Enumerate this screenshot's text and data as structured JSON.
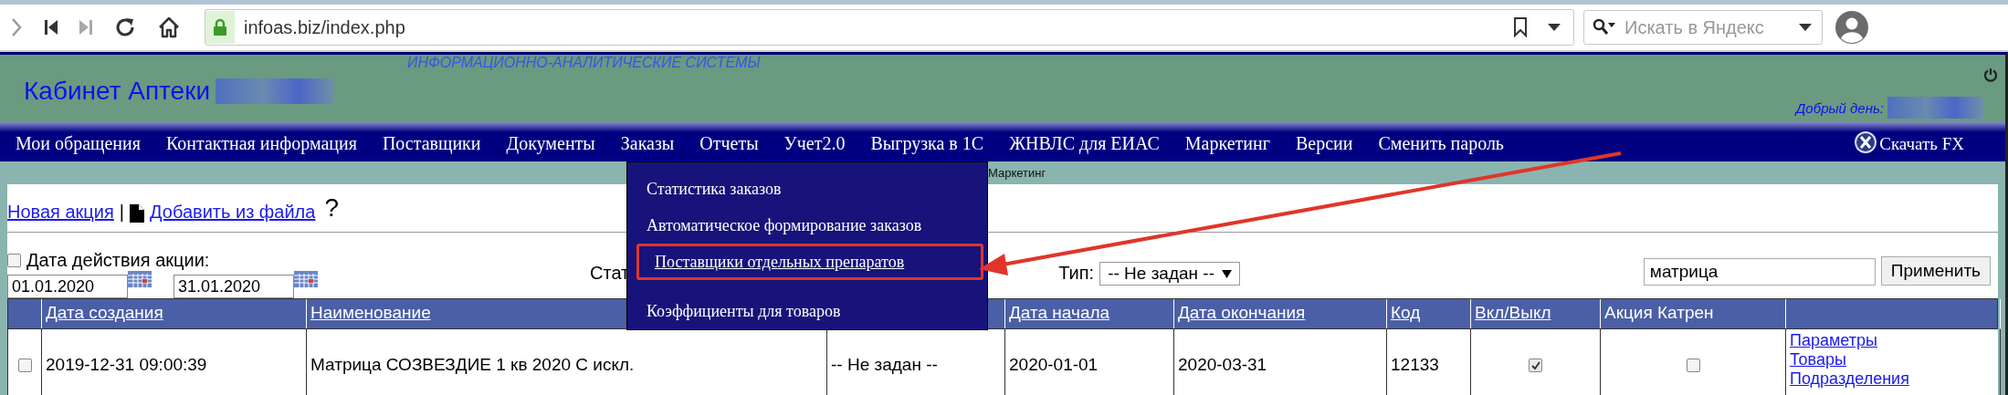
{
  "browser": {
    "url": "infoas.biz/index.php",
    "search": {
      "placeholder": "Искать в Яндекс"
    }
  },
  "header": {
    "tagline": "ИНФОРМАЦИОННО-АНАЛИТИЧЕСКИЕ СИСТЕМЫ",
    "title": "Кабинет Аптеки",
    "greeting": "Добрый день:"
  },
  "menu": {
    "items": [
      "Мои обращения",
      "Контактная информация",
      "Поставщики",
      "Документы",
      "Заказы",
      "Отчеты",
      "Учет2.0",
      "Выгрузка в 1С",
      "ЖНВЛС для ЕИАС",
      "Маркетинг",
      "Версии",
      "Сменить пароль"
    ],
    "download": "Скачать FX"
  },
  "breadcrumb": "Маркетинг",
  "dropdown": {
    "items": [
      {
        "label": "Статистика заказов",
        "selected": false
      },
      {
        "label": "Автоматическое формирование заказов",
        "selected": false
      },
      {
        "label": "Поставщики отдельных препаратов",
        "selected": true
      },
      {
        "label": "Коэффициенты для товаров",
        "selected": false
      }
    ]
  },
  "toolbar": {
    "new_link": "Новая акция",
    "separator": "|",
    "file_link": "Добавить из файла",
    "help": "?"
  },
  "filters": {
    "date_filter": {
      "label": "Дата действия акции:",
      "checked": false
    },
    "date_from": "01.01.2020",
    "date_to": "31.01.2020",
    "status_label": "Стат",
    "type_label": "Тип:",
    "type_value": "-- Не задан --",
    "search_value": "матрица",
    "apply": "Применить"
  },
  "table": {
    "columns": [
      {
        "kind": "select"
      },
      {
        "kind": "link",
        "label": "Дата создания"
      },
      {
        "kind": "link",
        "label": "Наименование"
      },
      {
        "kind": "blank"
      },
      {
        "kind": "link",
        "label": "Дата начала"
      },
      {
        "kind": "link",
        "label": "Дата окончания"
      },
      {
        "kind": "link",
        "label": "Код"
      },
      {
        "kind": "link",
        "label": "Вкл/Выкл"
      },
      {
        "kind": "text",
        "label": "Акция Катрен"
      },
      {
        "kind": "blank"
      }
    ],
    "rows": [
      {
        "selected": false,
        "created": "2019-12-31 09:00:39",
        "name": "Матрица СОЗВЕЗДИЕ 1 кв 2020 С искл.",
        "type": "-- Не задан --",
        "start": "2020-01-01",
        "end": "2020-03-31",
        "code": "12133",
        "enabled": true,
        "katren": false,
        "actions": [
          "Параметры",
          "Товары",
          "Подразделения"
        ]
      }
    ]
  }
}
